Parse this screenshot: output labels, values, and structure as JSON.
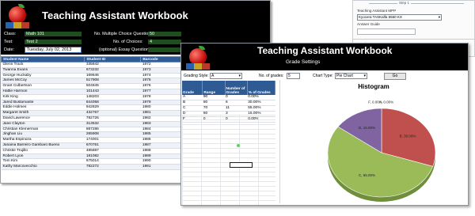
{
  "main_window": {
    "title": "Teaching Assistant Workbook",
    "fields": {
      "class_label": "Class:",
      "class_value": "Math 101",
      "test_label": "Test:",
      "test_value": "Test 2",
      "date_label": "Date:",
      "date_value": "Tuesday, July 02, 2013",
      "mc_label": "No. Multiple Choice Questions:",
      "mc_value": "50",
      "choices_label": "No. of Choices:",
      "choices_value": "4",
      "essay_label": "(optional) Essay Questions:",
      "essay_value": ""
    },
    "table": {
      "columns": [
        "Student Name",
        "Student ID",
        "Barcode"
      ],
      "rows": [
        [
          "Glenn Track",
          "335842",
          "1972"
        ],
        [
          "Twanna Evans",
          "673232",
          "1973"
        ],
        [
          "George Huckaby",
          "169646",
          "1974"
        ],
        [
          "James McCoy",
          "517908",
          "1975"
        ],
        [
          "Grant Culbertson",
          "504845",
          "1976"
        ],
        [
          "Hattie Harmon",
          "101443",
          "1977"
        ],
        [
          "Kirk King",
          "148203",
          "1978"
        ],
        [
          "Jared Bustamante",
          "844058",
          "1979"
        ],
        [
          "Eddie Holmes",
          "942829",
          "1980"
        ],
        [
          "Margaret Smith",
          "432767",
          "1981"
        ],
        [
          "David Lawrence",
          "782726",
          "1982"
        ],
        [
          "Jane Clayton",
          "313532",
          "1983"
        ],
        [
          "Christian Klemerman",
          "887286",
          "1984"
        ],
        [
          "Jinghan Liu",
          "265908",
          "1985"
        ],
        [
          "Martha Espinoza",
          "174001",
          "1986"
        ],
        [
          "Janaina Barreiro Gambaro Bueno",
          "670761",
          "1987"
        ],
        [
          "Christie Trujillo",
          "485887",
          "1988"
        ],
        [
          "Robert Lyon",
          "181082",
          "1989"
        ],
        [
          "Tom Kim",
          "675014",
          "1990"
        ],
        [
          "Kathy Marcovecchio",
          "782272",
          "1991"
        ]
      ]
    }
  },
  "project_panel": {
    "header": "Step 1",
    "line1": "Teaching Assistant MPP",
    "select_value": "Kyocera TASKalfa 5550 KX",
    "line3": "Answer Guide",
    "status": "Ready"
  },
  "grade_window": {
    "title": "Teaching Assistant Workbook",
    "subtitle": "Grade Settings",
    "controls": {
      "grading_style_label": "Grading Style:",
      "grading_style_value": "A",
      "num_grades_label": "No. of grades:",
      "num_grades_value": "5",
      "chart_type_label": "Chart Type:",
      "chart_type_value": "Pie Chart",
      "go_label": "Go"
    },
    "table": {
      "columns": [
        "Grade",
        "Range",
        "Number of Grades",
        "% of Grades"
      ],
      "rows": [
        [
          "A",
          "90",
          "0",
          "0.00%"
        ],
        [
          "B",
          "80",
          "6",
          "30.00%"
        ],
        [
          "C",
          "70",
          "11",
          "55.00%"
        ],
        [
          "D",
          "60",
          "3",
          "15.00%"
        ],
        [
          "F",
          "0",
          "0",
          "0.00%"
        ]
      ]
    }
  },
  "chart_data": {
    "type": "pie",
    "title": "Histogram",
    "series": [
      {
        "values": [
          0,
          30,
          55,
          15,
          0
        ],
        "labels": [
          "A, 0.00%",
          "B, 30.00%",
          "C, 55.00%",
          "D, 15.00%",
          "F, 0.00%"
        ]
      }
    ],
    "colors": [
      "#4f81bd",
      "#c0504d",
      "#9bbb59",
      "#8064a2",
      "#4bacc6"
    ]
  }
}
